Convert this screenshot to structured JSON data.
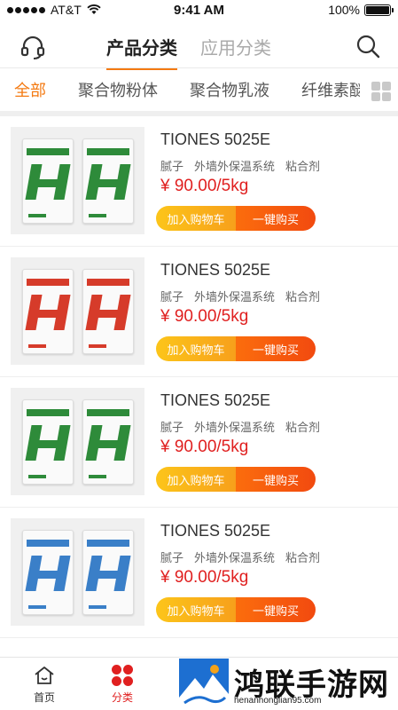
{
  "status_bar": {
    "carrier": "AT&T",
    "time": "9:41 AM",
    "battery": "100%",
    "battery_level": 1.0
  },
  "header": {
    "tabs": [
      {
        "label": "产品分类",
        "active": true
      },
      {
        "label": "应用分类",
        "active": false
      }
    ],
    "left_icon": "headset-icon",
    "right_icon": "search-icon"
  },
  "categories": {
    "items": [
      {
        "label": "全部",
        "active": true
      },
      {
        "label": "聚合物粉体",
        "active": false
      },
      {
        "label": "聚合物乳液",
        "active": false
      },
      {
        "label": "纤维素醚",
        "active": false
      }
    ],
    "more_icon": "grid-icon"
  },
  "products": [
    {
      "title": "TIONES 5025E",
      "tags": [
        "腻子",
        "外墙外保温系统",
        "粘合剂"
      ],
      "price": "¥ 90.00/5kg",
      "cart_label": "加入购物车",
      "buy_label": "一键购买",
      "bag_color": "#2e8b3a",
      "bag_band_color": "#2e8b3a"
    },
    {
      "title": "TIONES 5025E",
      "tags": [
        "腻子",
        "外墙外保温系统",
        "粘合剂"
      ],
      "price": "¥ 90.00/5kg",
      "cart_label": "加入购物车",
      "buy_label": "一键购买",
      "bag_color": "#d63b2a",
      "bag_band_color": "#d63b2a"
    },
    {
      "title": "TIONES 5025E",
      "tags": [
        "腻子",
        "外墙外保温系统",
        "粘合剂"
      ],
      "price": "¥ 90.00/5kg",
      "cart_label": "加入购物车",
      "buy_label": "一键购买",
      "bag_color": "#2e8b3a",
      "bag_band_color": "#2e8b3a"
    },
    {
      "title": "TIONES 5025E",
      "tags": [
        "腻子",
        "外墙外保温系统",
        "粘合剂"
      ],
      "price": "¥ 90.00/5kg",
      "cart_label": "加入购物车",
      "buy_label": "一键购买",
      "bag_color": "#3a7fc8",
      "bag_band_color": "#3a7fc8"
    }
  ],
  "tabbar": {
    "items": [
      {
        "label": "首页",
        "icon": "home-icon",
        "active": false
      },
      {
        "label": "分类",
        "icon": "category-icon",
        "active": true
      }
    ]
  },
  "watermark": {
    "text": "鸿联手游网",
    "url": "henanhonglian95.com"
  },
  "colors": {
    "accent": "#f47a12",
    "price": "#e02020",
    "cart_button": "#fcc51a",
    "buy_button": "#f24a0f"
  }
}
